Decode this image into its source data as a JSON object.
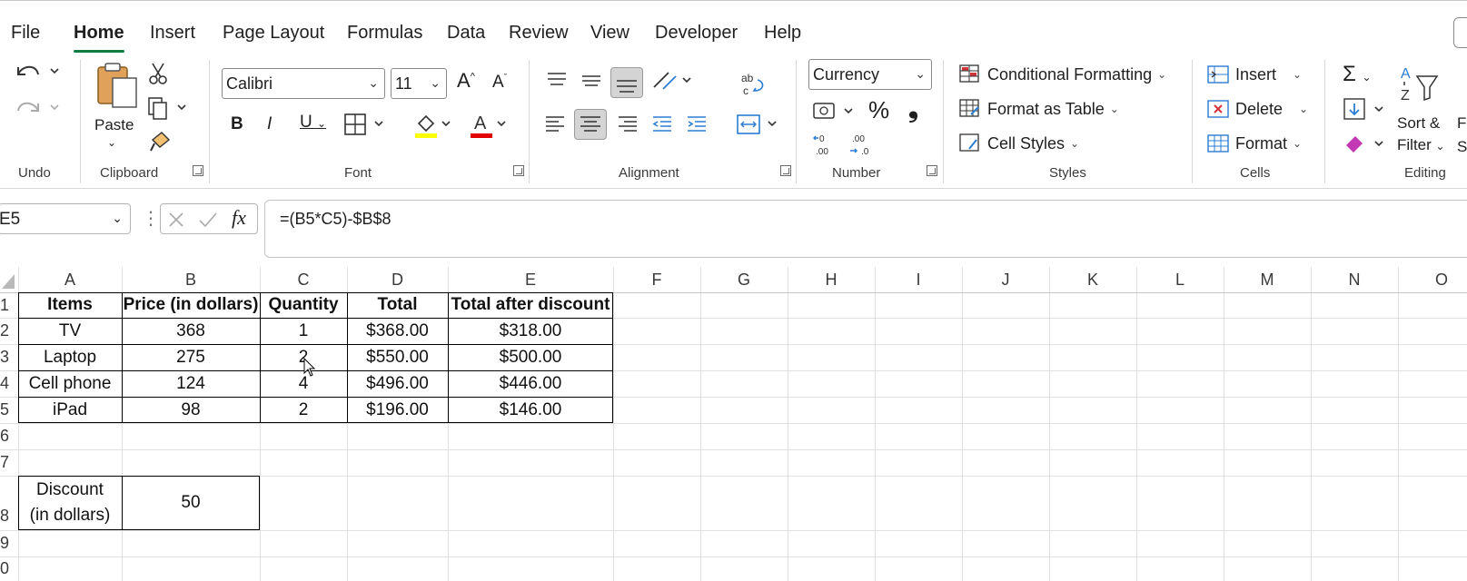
{
  "tabs": [
    "File",
    "Home",
    "Insert",
    "Page Layout",
    "Formulas",
    "Data",
    "Review",
    "View",
    "Developer",
    "Help"
  ],
  "ribbon": {
    "groups": {
      "undo": "Undo",
      "clipboard": "Clipboard",
      "font": "Font",
      "alignment": "Alignment",
      "number": "Number",
      "styles": "Styles",
      "cells": "Cells",
      "editing": "Editing"
    },
    "paste_label": "Paste",
    "font_name": "Calibri",
    "font_size": "11",
    "number_format": "Currency",
    "conditional_formatting": "Conditional Formatting",
    "format_as_table": "Format as Table",
    "cell_styles": "Cell Styles",
    "insert": "Insert",
    "delete": "Delete",
    "format": "Format",
    "sort_filter_1": "Sort &",
    "sort_filter_2": "Filter",
    "find_select_1": "F",
    "find_select_2": "Se",
    "accent_fill": "#ffff00",
    "accent_font": "#e00000"
  },
  "formula_bar": {
    "name_box": "E5",
    "formula": "=(B5*C5)-$B$8"
  },
  "columns": [
    "A",
    "B",
    "C",
    "D",
    "E",
    "F",
    "G",
    "H",
    "I",
    "J",
    "K",
    "L",
    "M",
    "N",
    "O"
  ],
  "rows": [
    "1",
    "2",
    "3",
    "4",
    "5",
    "6",
    "7",
    "8",
    "9",
    "0"
  ],
  "table": {
    "headers": [
      "Items",
      "Price (in dollars)",
      "Quantity",
      "Total",
      "Total after discount"
    ],
    "rows": [
      [
        "TV",
        "368",
        "1",
        "$368.00",
        "$318.00"
      ],
      [
        "Laptop",
        "275",
        "2",
        "$550.00",
        "$500.00"
      ],
      [
        "Cell phone",
        "124",
        "4",
        "$496.00",
        "$446.00"
      ],
      [
        "iPad",
        "98",
        "2",
        "$196.00",
        "$146.00"
      ]
    ]
  },
  "discount": {
    "label_line1": "Discount",
    "label_line2": "(in dollars)",
    "value": "50"
  }
}
